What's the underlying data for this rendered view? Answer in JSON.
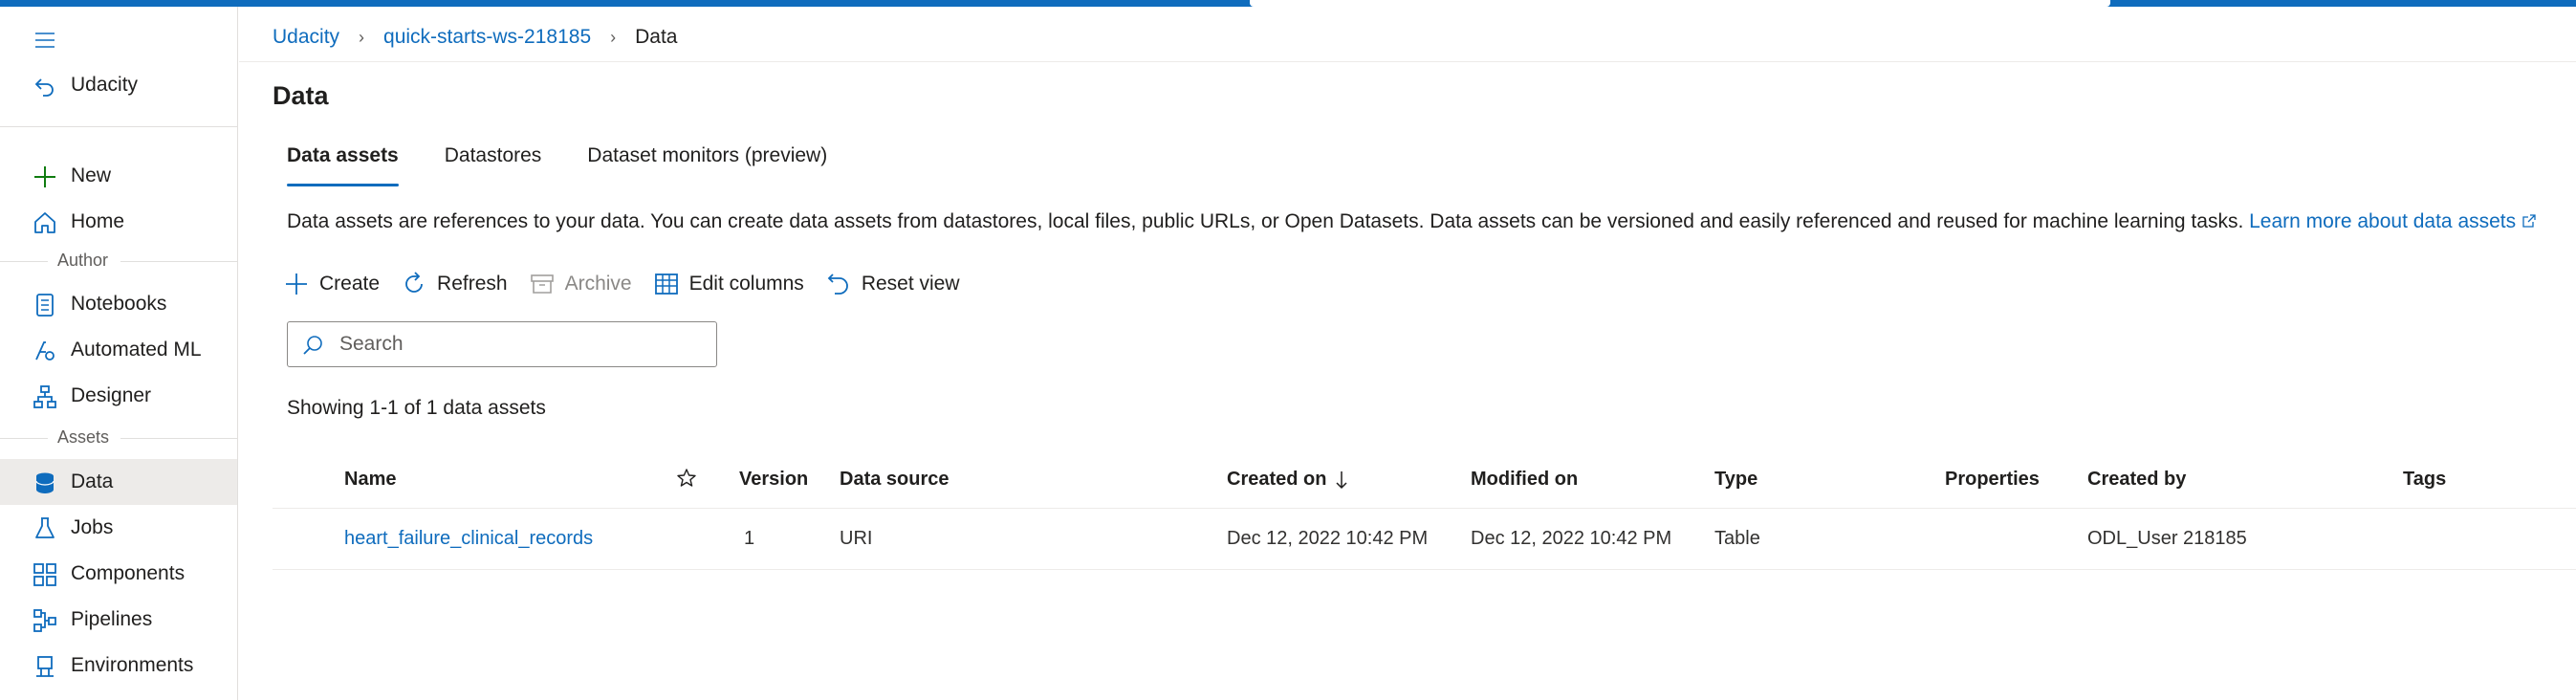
{
  "sidebar": {
    "workspace": "Udacity",
    "new_label": "New",
    "home_label": "Home",
    "author_section": "Author",
    "author_items": [
      {
        "label": "Notebooks"
      },
      {
        "label": "Automated ML"
      },
      {
        "label": "Designer"
      }
    ],
    "assets_section": "Assets",
    "asset_items": [
      {
        "label": "Data",
        "active": true
      },
      {
        "label": "Jobs"
      },
      {
        "label": "Components"
      },
      {
        "label": "Pipelines"
      },
      {
        "label": "Environments"
      }
    ]
  },
  "breadcrumb": {
    "items": [
      "Udacity",
      "quick-starts-ws-218185"
    ],
    "current": "Data"
  },
  "page": {
    "title": "Data",
    "tabs": [
      {
        "label": "Data assets",
        "active": true
      },
      {
        "label": "Datastores"
      },
      {
        "label": "Dataset monitors (preview)"
      }
    ],
    "description": "Data assets are references to your data. You can create data assets from datastores, local files, public URLs, or Open Datasets. Data assets can be versioned and easily referenced and reused for machine learning tasks.",
    "learn_more": "Learn more about data assets"
  },
  "toolbar": {
    "create": "Create",
    "refresh": "Refresh",
    "archive": "Archive",
    "edit_columns": "Edit columns",
    "reset_view": "Reset view"
  },
  "search": {
    "placeholder": "Search"
  },
  "showing_text": "Showing 1-1 of 1 data assets",
  "table": {
    "columns": {
      "name": "Name",
      "version": "Version",
      "data_source": "Data source",
      "created_on": "Created on",
      "modified_on": "Modified on",
      "type": "Type",
      "properties": "Properties",
      "created_by": "Created by",
      "tags": "Tags"
    },
    "rows": [
      {
        "name": "heart_failure_clinical_records",
        "version": "1",
        "data_source": "URI",
        "created_on": "Dec 12, 2022 10:42 PM",
        "modified_on": "Dec 12, 2022 10:42 PM",
        "type": "Table",
        "properties": "",
        "created_by": "ODL_User 218185",
        "tags": ""
      }
    ]
  },
  "colors": {
    "accent": "#0f6cbd",
    "text": "#201f1e",
    "muted": "#605e5c",
    "active_bg": "#edebe9"
  }
}
